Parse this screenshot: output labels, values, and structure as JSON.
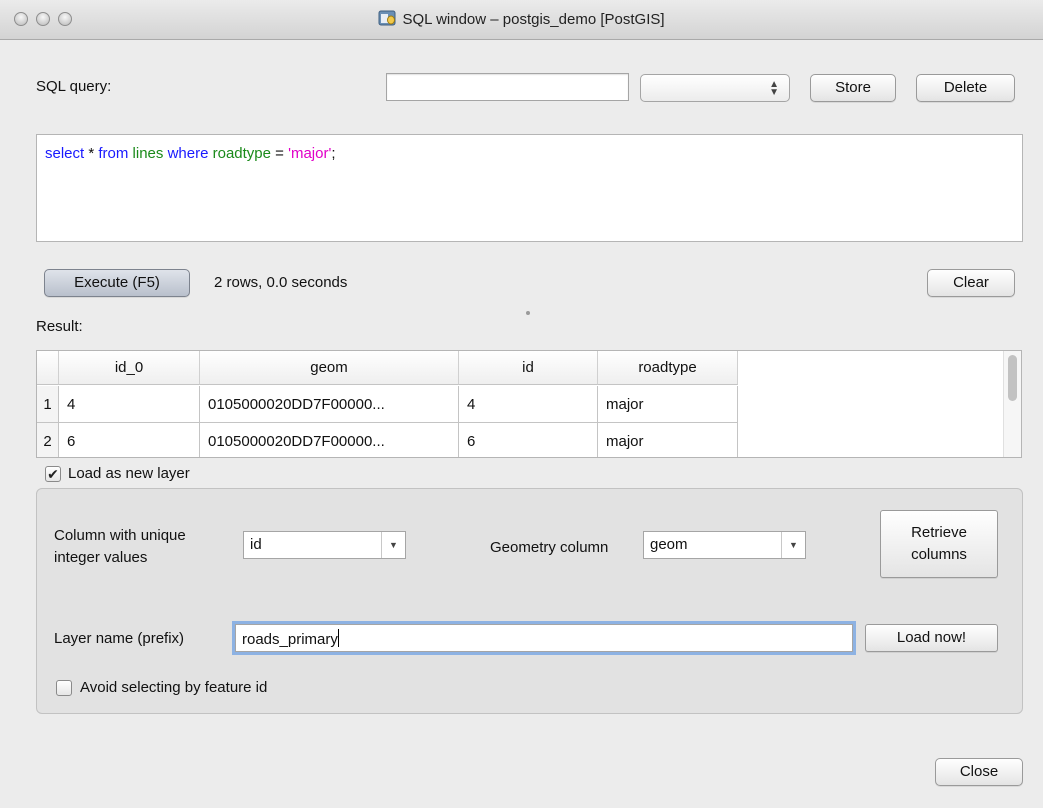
{
  "window": {
    "title": "SQL window – postgis_demo [PostGIS]"
  },
  "query_bar": {
    "label": "SQL query:",
    "name_value": "",
    "stored_value": "",
    "store_label": "Store",
    "delete_label": "Delete"
  },
  "sql": {
    "tokens": [
      {
        "text": "select",
        "kind": "kw"
      },
      {
        "text": " * ",
        "kind": "plain"
      },
      {
        "text": "from",
        "kind": "kw"
      },
      {
        "text": " ",
        "kind": "plain"
      },
      {
        "text": "lines",
        "kind": "id"
      },
      {
        "text": " ",
        "kind": "plain"
      },
      {
        "text": "where",
        "kind": "kw"
      },
      {
        "text": " ",
        "kind": "plain"
      },
      {
        "text": "roadtype",
        "kind": "id"
      },
      {
        "text": " = ",
        "kind": "plain"
      },
      {
        "text": "'major'",
        "kind": "str"
      },
      {
        "text": ";",
        "kind": "plain"
      }
    ],
    "colors": {
      "keyword": "#1a1aff",
      "identifier": "#1a8a1a",
      "string": "#e000c8"
    }
  },
  "execute": {
    "button_label": "Execute (F5)",
    "status": "2 rows, 0.0 seconds",
    "clear_label": "Clear"
  },
  "result": {
    "label": "Result:",
    "columns": [
      "id_0",
      "geom",
      "id",
      "roadtype"
    ],
    "rows": [
      {
        "num": "1",
        "cells": [
          "4",
          "0105000020DD7F00000...",
          "4",
          "major"
        ]
      },
      {
        "num": "2",
        "cells": [
          "6",
          "0105000020DD7F00000...",
          "6",
          "major"
        ]
      }
    ]
  },
  "load_layer": {
    "checkbox_label": "Load as new layer",
    "checked": true,
    "unique_column_label_1": "Column with unique",
    "unique_column_label_2": "integer values",
    "unique_column_value": "id",
    "geometry_label": "Geometry column",
    "geometry_value": "geom",
    "retrieve_label_1": "Retrieve",
    "retrieve_label_2": "columns",
    "layer_name_label": "Layer name (prefix)",
    "layer_name_value": "roads_primary",
    "load_now_label": "Load now!",
    "avoid_label": "Avoid selecting by feature id",
    "avoid_checked": false
  },
  "footer": {
    "close_label": "Close"
  }
}
